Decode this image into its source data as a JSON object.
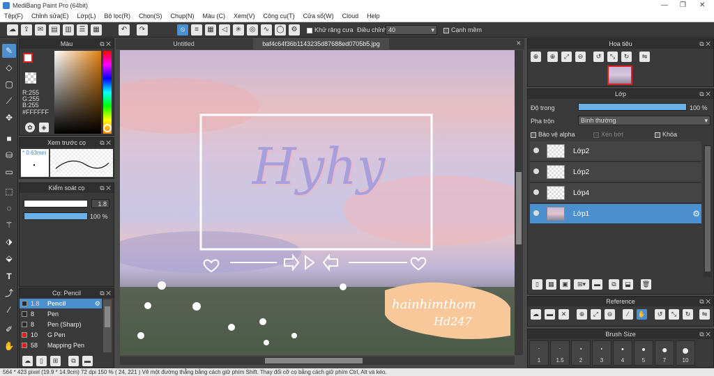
{
  "app": {
    "title": "MediBang Paint Pro (64bit)"
  },
  "menu": [
    "Tệp(F)",
    "Chỉnh sửa(E)",
    "Lớp(L)",
    "Bộ lọc(R)",
    "Chọn(S)",
    "Chụp(N)",
    "Màu (C)",
    "Xem(V)",
    "Công cụ(T)",
    "Cửa sổ(W)",
    "Cloud",
    "Help"
  ],
  "toolbar": {
    "antialias_label": "Khử răng cưa",
    "correction_label": "Điều chỉnh",
    "correction_value": "40",
    "snap_label": "Cạnh mềm"
  },
  "color_panel": {
    "title": "Màu",
    "r": "R:255",
    "g": "G:255",
    "b": "B:255",
    "hex": "#FFFFFF",
    "primary_color": "#e02020"
  },
  "preview_panel": {
    "title": "Xem trước cọ",
    "size": "* 0.63mm"
  },
  "control_panel": {
    "title": "Kiểm soát cọ",
    "size_value": "1.8",
    "opacity_value": "100 %",
    "opacity": 1.0
  },
  "brush_panel": {
    "title": "Cọ: Pencil",
    "items": [
      {
        "size": "1.8",
        "name": "Pencil",
        "color": "#2a2a2a",
        "selected": true
      },
      {
        "size": "8",
        "name": "Pen",
        "color": "#2a2a2a",
        "selected": false
      },
      {
        "size": "8",
        "name": "Pen (Sharp)",
        "color": "#2a2a2a",
        "selected": false
      },
      {
        "size": "10",
        "name": "G Pen",
        "color": "#e02020",
        "selected": false
      },
      {
        "size": "58",
        "name": "Mapping Pen",
        "color": "#e02020",
        "selected": false
      }
    ]
  },
  "canvas": {
    "tabs": [
      "Untitled",
      "baf4c64f36b1143235d87688ed0705b5.jpg"
    ],
    "art_text": "Hyhy",
    "signature_line1": "hainhimthom",
    "signature_line2": "Hd247"
  },
  "navigator": {
    "title": "Hoa tiêu"
  },
  "layer_panel": {
    "title": "Lớp",
    "opacity_label": "Độ trong",
    "opacity_value": "100 %",
    "opacity": 1.0,
    "blend_label": "Pha trộn",
    "blend_value": "Bình thường",
    "protect_alpha": "Bảo vệ alpha",
    "clip": "Xén bớt",
    "lock": "Khóa",
    "layers": [
      {
        "name": "Lớp2",
        "selected": false
      },
      {
        "name": "Lớp2",
        "selected": false
      },
      {
        "name": "Lớp4",
        "selected": false
      },
      {
        "name": "Lớp1",
        "selected": true
      }
    ]
  },
  "reference_panel": {
    "title": "Reference"
  },
  "brushsize_panel": {
    "title": "Brush Size",
    "sizes": [
      "1",
      "1.5",
      "2",
      "3",
      "4",
      "5",
      "7",
      "10"
    ]
  },
  "statusbar": {
    "text": "564 * 423 pixel   (19.9 * 14.9cm)   72 dpi   150 %   ( 24, 221 )   Vẽ một đường thẳng bằng cách giữ phím Shift. Thay đổi cỡ cọ bằng cách giữ phím Ctrl, Alt và kéo."
  }
}
